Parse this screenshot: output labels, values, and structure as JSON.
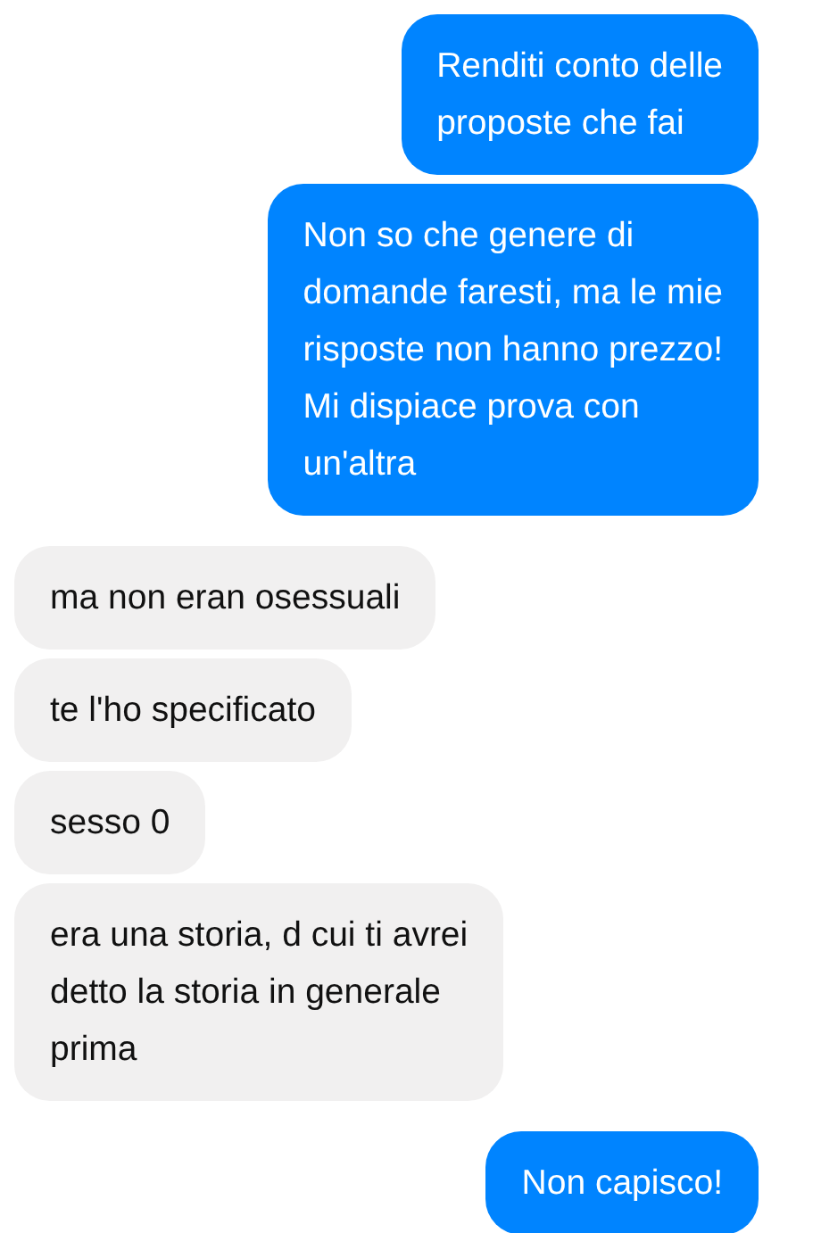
{
  "messages": [
    {
      "kind": "sent",
      "text": "Renditi conto delle\nproposte che fai"
    },
    {
      "kind": "sent",
      "text": "Non so che genere di\ndomande faresti, ma le mie\nrisposte non hanno prezzo!\nMi dispiace prova con\nun'altra"
    },
    {
      "kind": "received",
      "text": "ma non eran osessuali"
    },
    {
      "kind": "received",
      "text": "te l'ho specificato"
    },
    {
      "kind": "received",
      "text": "sesso 0"
    },
    {
      "kind": "received",
      "text": "era una storia, d cui ti avrei\ndetto la storia in generale\nprima"
    },
    {
      "kind": "sent",
      "text": "Non capisco!"
    }
  ]
}
